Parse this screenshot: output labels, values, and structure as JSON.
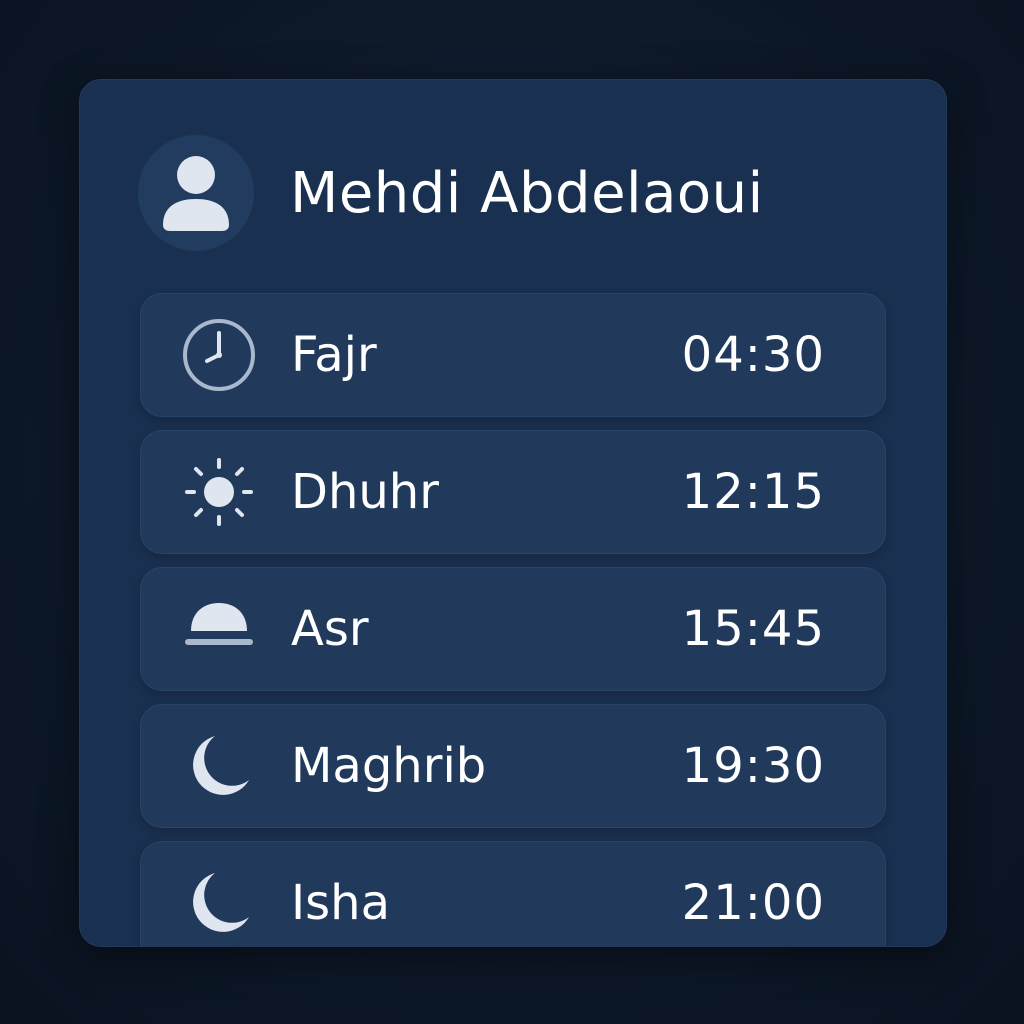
{
  "user": {
    "name": "Mehdi Abdelaoui",
    "avatar_icon": "user-avatar-icon"
  },
  "prayers": [
    {
      "name": "Fajr",
      "time": "04:30",
      "icon": "clock-icon"
    },
    {
      "name": "Dhuhr",
      "time": "12:15",
      "icon": "sun-icon"
    },
    {
      "name": "Asr",
      "time": "15:45",
      "icon": "sunset-icon"
    },
    {
      "name": "Maghrib",
      "time": "19:30",
      "icon": "crescent-moon-icon"
    },
    {
      "name": "Isha",
      "time": "21:00",
      "icon": "crescent-moon-icon"
    }
  ],
  "colors": {
    "background": "#0d1828",
    "card": "#1a3050",
    "row": "#213a5c",
    "icon": "#dfe6ef",
    "text": "#ffffff"
  }
}
